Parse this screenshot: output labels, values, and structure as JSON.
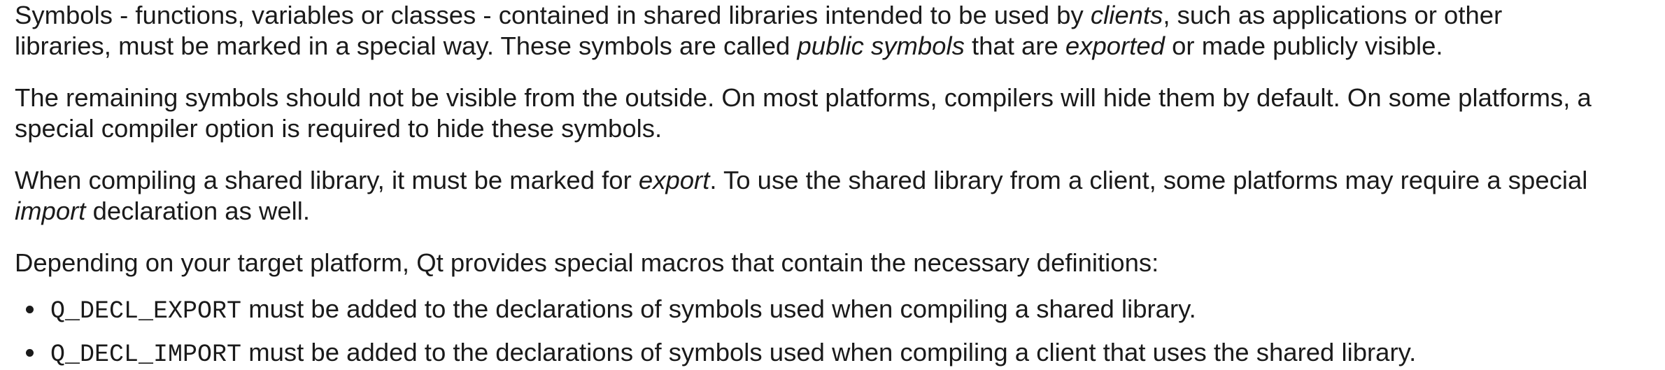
{
  "paragraphs": [
    {
      "lines": [
        [
          {
            "text": "Symbols - functions, variables or classes - contained in shared libraries intended to be used by "
          },
          {
            "text": "clients",
            "italic": true
          },
          {
            "text": ", such as applications or other"
          }
        ],
        [
          {
            "text": "libraries, must be marked in a special way. These symbols are called "
          },
          {
            "text": "public symbols",
            "italic": true
          },
          {
            "text": " that are "
          },
          {
            "text": "exported",
            "italic": true
          },
          {
            "text": " or made publicly visible."
          }
        ]
      ]
    },
    {
      "lines": [
        [
          {
            "text": "The remaining symbols should not be visible from the outside. On most platforms, compilers will hide them by default. On some platforms, a"
          }
        ],
        [
          {
            "text": "special compiler option is required to hide these symbols."
          }
        ]
      ]
    },
    {
      "lines": [
        [
          {
            "text": "When compiling a shared library, it must be marked for "
          },
          {
            "text": "export",
            "italic": true
          },
          {
            "text": ". To use the shared library from a client, some platforms may require a special"
          }
        ],
        [
          {
            "text": "import",
            "italic": true
          },
          {
            "text": " declaration as well."
          }
        ]
      ]
    },
    {
      "lines": [
        [
          {
            "text": "Depending on your target platform, Qt provides special macros that contain the necessary definitions:"
          }
        ]
      ]
    }
  ],
  "bullets": [
    {
      "code": "Q_DECL_EXPORT",
      "text": " must be added to the declarations of symbols used when compiling a shared library."
    },
    {
      "code": "Q_DECL_IMPORT",
      "text": " must be added to the declarations of symbols used when compiling a client that uses the shared library."
    }
  ]
}
